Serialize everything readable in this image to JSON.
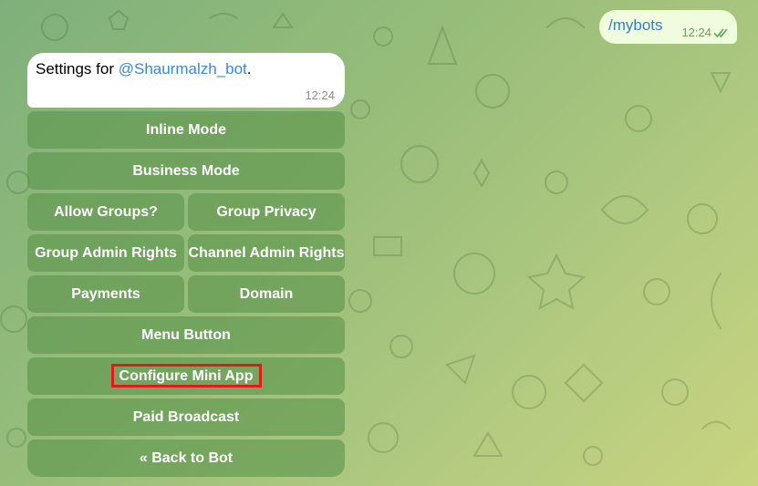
{
  "outgoing": {
    "text": "/mybots",
    "time": "12:24"
  },
  "incoming": {
    "prefix": "Settings for ",
    "link": "@Shaurmalzh_bot",
    "suffix": ".",
    "time": "12:24"
  },
  "keyboard": {
    "inline_mode": "Inline Mode",
    "business_mode": "Business Mode",
    "allow_groups": "Allow Groups?",
    "group_privacy": "Group Privacy",
    "group_admin_rights": "Group Admin Rights",
    "channel_admin_rights": "Channel Admin Rights",
    "payments": "Payments",
    "domain": "Domain",
    "menu_button": "Menu Button",
    "configure_mini_app": "Configure Mini App",
    "paid_broadcast": "Paid Broadcast",
    "back_to_bot": "« Back to Bot"
  },
  "colors": {
    "button_bg": "#5c944c",
    "highlight": "#e01b1b",
    "link": "#3a88d4",
    "outgoing_bubble": "#effdde"
  },
  "icons": {
    "read_receipt": "double-check-icon"
  }
}
